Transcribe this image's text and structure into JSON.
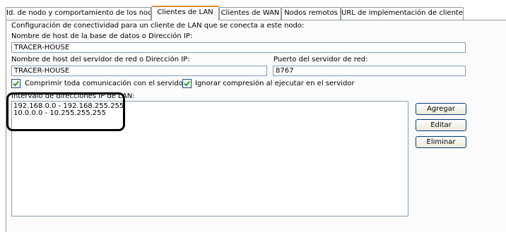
{
  "tabs": [
    {
      "label": "Id. de nodo y comportamiento de los nodos"
    },
    {
      "label": "Clientes de LAN"
    },
    {
      "label": "Clientes de WAN"
    },
    {
      "label": "Nodos remotos"
    },
    {
      "label": "URL de implementación de cliente"
    }
  ],
  "panel": {
    "description": "Configuración de conectividad para un cliente de LAN que se conecta a este nodo:",
    "db_host_label": "Nombre de host de la base de datos o Dirección IP:",
    "db_host_value": "TRACER-HOUSE",
    "net_host_label": "Nombre de host del servidor de red o Dirección IP:",
    "net_host_value": "TRACER-HOUSE",
    "net_port_label": "Puerto del servidor de red:",
    "net_port_value": "8767",
    "compress_label": "Comprimir toda comunicación con el servidor",
    "compress_checked": true,
    "ignore_label": "Ignorar compresión al ejecutar en el servidor",
    "ignore_checked": true,
    "ranges_label": "Intervalo de direcciones IP de LAN:",
    "ranges": [
      "192.168.0.0 - 192.168.255.255",
      "10.0.0.0 - 10.255.255.255"
    ]
  },
  "buttons": {
    "add": "Agregar",
    "edit": "Editar",
    "delete": "Eliminar"
  },
  "colors": {
    "active_tab_accent": "#e68b2c",
    "field_border": "#7f9db9",
    "checkbox_check": "#21a121"
  }
}
